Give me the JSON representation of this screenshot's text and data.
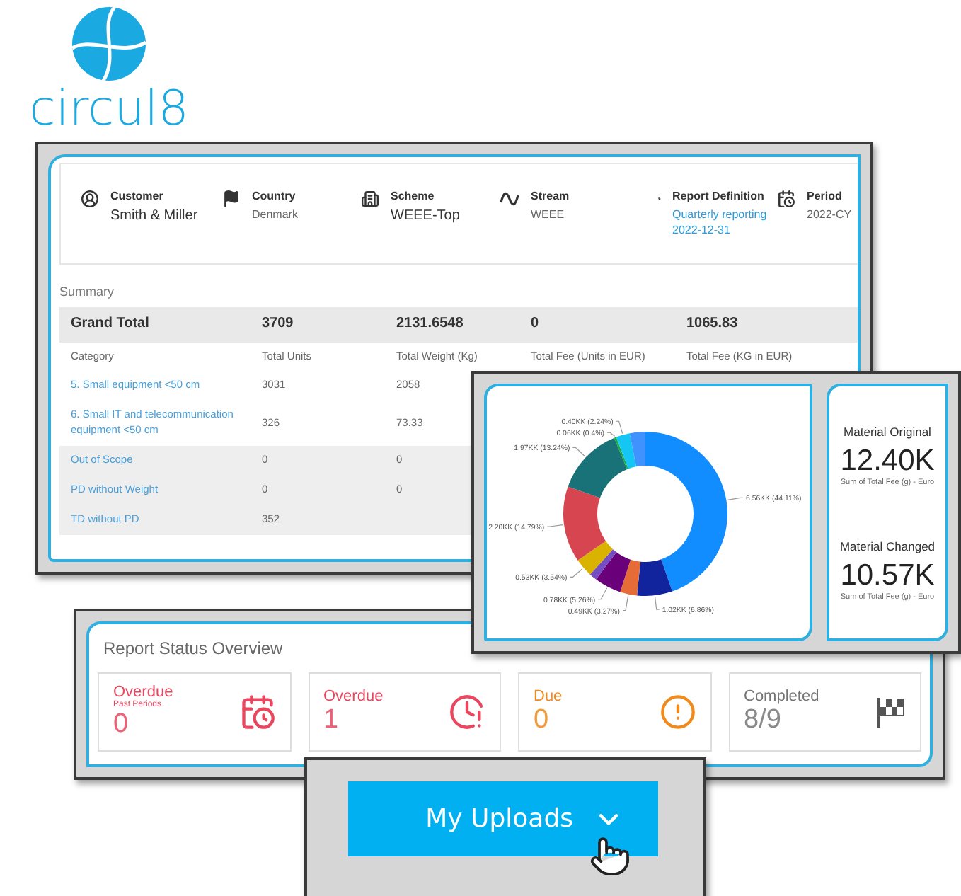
{
  "logo": {
    "text": "circul8"
  },
  "report": {
    "fields": [
      {
        "kind": "customer",
        "label": "Customer",
        "value": "Smith & Miller"
      },
      {
        "kind": "country",
        "label": "Country",
        "value": "Denmark"
      },
      {
        "kind": "scheme",
        "label": "Scheme",
        "value": "WEEE-Top"
      },
      {
        "kind": "stream",
        "label": "Stream",
        "value": "WEEE"
      },
      {
        "kind": "definition",
        "label": "Report Definition",
        "value": "Quarterly reporting 2022-12-31"
      },
      {
        "kind": "period",
        "label": "Period",
        "value": "2022-CY"
      }
    ],
    "summary_title": "Summary",
    "grand_total": [
      "Grand Total",
      "3709",
      "2131.6548",
      "0",
      "1065.83"
    ],
    "columns": [
      "Category",
      "Total Units",
      "Total Weight (Kg)",
      "Total Fee (Units in EUR)",
      "Total Fee (KG in EUR)"
    ],
    "rows": [
      {
        "cells": [
          "5. Small equipment <50 cm",
          "3031",
          "2058"
        ],
        "shaded": false
      },
      {
        "cells": [
          "6. Small IT and telecommunication equipment <50 cm",
          "326",
          "73.33"
        ],
        "shaded": false
      },
      {
        "cells": [
          "Out of Scope",
          "0",
          "0"
        ],
        "shaded": true
      },
      {
        "cells": [
          "PD without Weight",
          "0",
          "0"
        ],
        "shaded": true
      },
      {
        "cells": [
          "TD without PD",
          "352"
        ],
        "shaded": true
      }
    ]
  },
  "dashboard": {
    "chart_data": {
      "type": "donut",
      "values": [
        6.56,
        1.02,
        0.49,
        0.78,
        0.22,
        0.53,
        2.2,
        1.97,
        0.06,
        0.4,
        0.45
      ],
      "colors": [
        "#118dff",
        "#12239e",
        "#e66c37",
        "#6b007b",
        "#744ec2",
        "#d9b300",
        "#d64550",
        "#197278",
        "#1aab40",
        "#15c6f4",
        "#4092ff"
      ],
      "value_labels": [
        "6.56KK (44.11%)",
        "1.02KK (6.86%)",
        "0.49KK (3.27%)",
        "0.78KK (5.26%)",
        null,
        "0.53KK (3.54%)",
        "2.20KK (14.79%)",
        "1.97KK (13.24%)",
        "0.06KK (0.4%)",
        "0.40KK (2.24%)",
        null
      ]
    },
    "kpis": [
      {
        "title": "Material Original",
        "value": "12.40K",
        "caption": "Sum of Total Fee (g) - Euro"
      },
      {
        "title": "Material Changed",
        "value": "10.57K",
        "caption": "Sum of Total Fee (g) - Euro"
      }
    ]
  },
  "status": {
    "title": "Report Status Overview",
    "cards": [
      {
        "kind": "calendar",
        "label": "Overdue",
        "sublabel": "Past Periods",
        "value": "0",
        "color": "#e8475f"
      },
      {
        "kind": "clock",
        "label": "Overdue",
        "value": "1",
        "color": "#e8475f"
      },
      {
        "kind": "alert",
        "label": "Due",
        "value": "0",
        "color": "#f08a1c"
      },
      {
        "kind": "flag",
        "label": "Completed",
        "value": "8/9",
        "color": "#757575"
      }
    ]
  },
  "uploads": {
    "label": "My Uploads"
  }
}
